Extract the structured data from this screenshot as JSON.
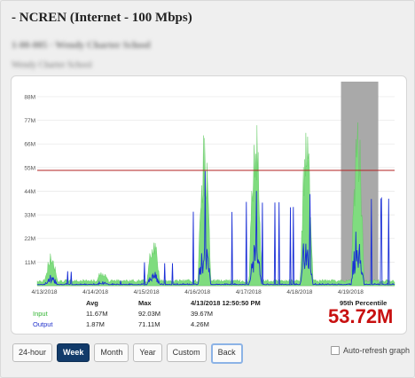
{
  "header": {
    "title": "- NCREN (Internet - 100 Mbps)",
    "sub1": "1-00-005 · Wendy Charter School",
    "sub2": "Wendy Charter School"
  },
  "chart_data": {
    "type": "area",
    "x_ticks": [
      "4/13/2018",
      "4/14/2018",
      "4/15/2018",
      "4/16/2018",
      "4/17/2018",
      "4/18/2018",
      "4/19/2018"
    ],
    "y_ticks": [
      "11M",
      "22M",
      "33M",
      "44M",
      "55M",
      "66M",
      "77M",
      "88M"
    ],
    "ylim": [
      0,
      95
    ],
    "percentile_line": 53.72,
    "series": [
      {
        "name": "Input",
        "color": "#7fdc7f"
      },
      {
        "name": "Output",
        "color": "#1a2fd6"
      }
    ],
    "highlight_color": "#a9a9a9"
  },
  "stats": {
    "avg_label": "Avg",
    "max_label": "Max",
    "time_label": "4/13/2018 12:50:50 PM",
    "input_label": "Input",
    "output_label": "Output",
    "input_avg": "11.67M",
    "input_max": "92.03M",
    "input_now": "39.67M",
    "output_avg": "1.87M",
    "output_max": "71.11M",
    "output_now": "4.26M",
    "percentile_label": "95th Percentile",
    "percentile_value": "53.72M"
  },
  "buttons": [
    "24-hour",
    "Week",
    "Month",
    "Year",
    "Custom",
    "Back"
  ],
  "auto_refresh_label": "Auto-refresh graph"
}
